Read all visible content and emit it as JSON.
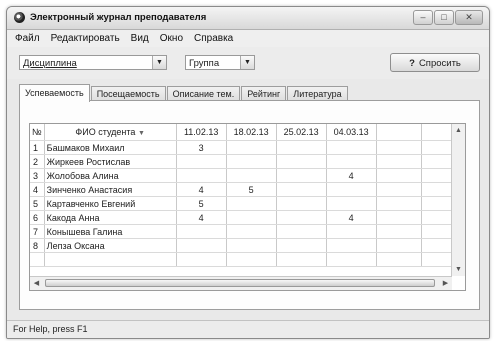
{
  "window": {
    "title": "Электронный журнал преподавателя"
  },
  "menu": [
    {
      "label": "Файл"
    },
    {
      "label": "Редактировать"
    },
    {
      "label": "Вид"
    },
    {
      "label": "Окно"
    },
    {
      "label": "Справка"
    }
  ],
  "toolbar": {
    "discipline": "Дисциплина",
    "group": "Группа",
    "ask_label": "Спросить"
  },
  "tabs": [
    {
      "label": "Успеваемость",
      "active": true
    },
    {
      "label": "Посещаемость",
      "active": false
    },
    {
      "label": "Описание тем.",
      "active": false
    },
    {
      "label": "Рейтинг",
      "active": false
    },
    {
      "label": "Литература",
      "active": false
    }
  ],
  "grid": {
    "columns": [
      "№",
      "ФИО студента",
      "11.02.13",
      "18.02.13",
      "25.02.13",
      "04.03.13",
      "",
      ""
    ],
    "rows": [
      [
        "1",
        "Башмаков Михаил",
        "3",
        "",
        "",
        ""
      ],
      [
        "2",
        "Жиркеев Ростислав",
        "",
        "",
        "",
        ""
      ],
      [
        "3",
        "Жолобова Алина",
        "",
        "",
        "",
        "4"
      ],
      [
        "4",
        "Зинченко Анастасия",
        "4",
        "5",
        "",
        ""
      ],
      [
        "5",
        "Картавченко Евгений",
        "5",
        "",
        "",
        ""
      ],
      [
        "6",
        "Какода Анна",
        "4",
        "",
        "",
        "4"
      ],
      [
        "7",
        "Конышева Галина",
        "",
        "",
        "",
        ""
      ],
      [
        "8",
        "Лепза Оксана",
        "",
        "",
        "",
        ""
      ],
      [
        "",
        "",
        "",
        "",
        "",
        ""
      ]
    ]
  },
  "status": "For Help, press F1"
}
